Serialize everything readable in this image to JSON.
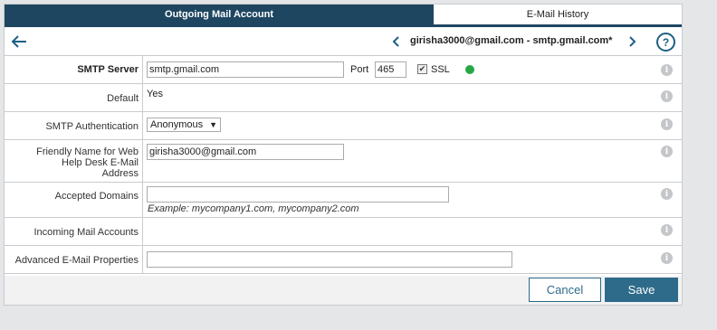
{
  "tabs": [
    {
      "label": "Outgoing Mail Account",
      "active": true
    },
    {
      "label": "E-Mail History",
      "active": false
    }
  ],
  "toolbar": {
    "back_icon": "arrow-left-icon",
    "prev_icon": "chevron-left-icon",
    "next_icon": "chevron-right-icon",
    "account_title": "girisha3000@gmail.com - smtp.gmail.com*",
    "help_label": "?"
  },
  "form": {
    "smtp_server": {
      "label": "SMTP Server",
      "value": "smtp.gmail.com",
      "port_label": "Port",
      "port_value": "465",
      "ssl_label": "SSL",
      "ssl_checked": true,
      "status_color": "#28a745"
    },
    "default": {
      "label": "Default",
      "value": "Yes"
    },
    "smtp_auth": {
      "label": "SMTP Authentication",
      "value": "Anonymous"
    },
    "friendly_name": {
      "label": "Friendly Name for Web Help Desk E-Mail Address",
      "value": "girisha3000@gmail.com"
    },
    "accepted_domains": {
      "label": "Accepted Domains",
      "value": "",
      "example": "Example: mycompany1.com, mycompany2.com"
    },
    "incoming_accounts": {
      "label": "Incoming Mail Accounts"
    },
    "advanced": {
      "label": "Advanced E-Mail Properties",
      "value": ""
    },
    "info_glyph": "i"
  },
  "footer": {
    "cancel_label": "Cancel",
    "save_label": "Save"
  },
  "colors": {
    "primary": "#1e4661",
    "button": "#2e6b8a",
    "status_ok": "#28a745"
  }
}
